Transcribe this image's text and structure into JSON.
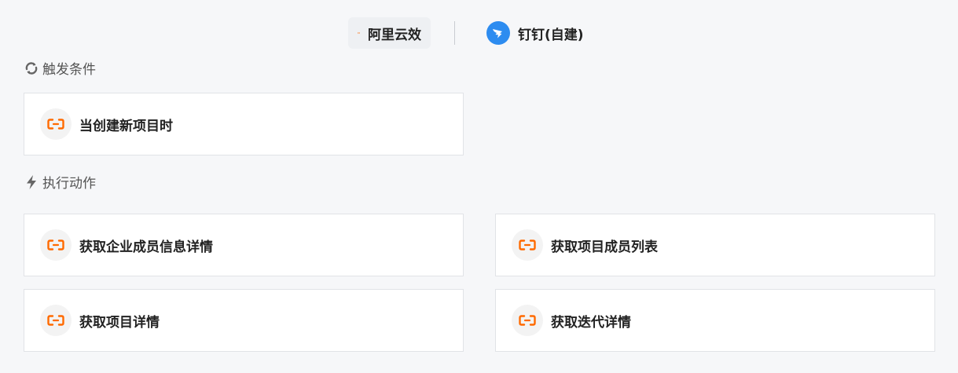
{
  "tabs": [
    {
      "label": "阿里云效",
      "icon": "aliyun-logo-icon",
      "active": true
    },
    {
      "label": "钉钉(自建)",
      "icon": "dingtalk-logo-icon",
      "active": false
    }
  ],
  "trigger_section": {
    "title": "触发条件",
    "icon": "refresh-icon",
    "cards": [
      {
        "label": "当创建新项目时",
        "icon": "aliyun-logo-icon"
      }
    ]
  },
  "action_section": {
    "title": "执行动作",
    "icon": "lightning-icon",
    "cards": [
      {
        "label": "获取企业成员信息详情",
        "icon": "aliyun-logo-icon"
      },
      {
        "label": "获取项目成员列表",
        "icon": "aliyun-logo-icon"
      },
      {
        "label": "获取项目详情",
        "icon": "aliyun-logo-icon"
      },
      {
        "label": "获取迭代详情",
        "icon": "aliyun-logo-icon"
      }
    ]
  },
  "colors": {
    "aliyun_orange": "#ff6a00",
    "dingtalk_blue": "#2d8cf0",
    "background": "#f6f7f9"
  }
}
